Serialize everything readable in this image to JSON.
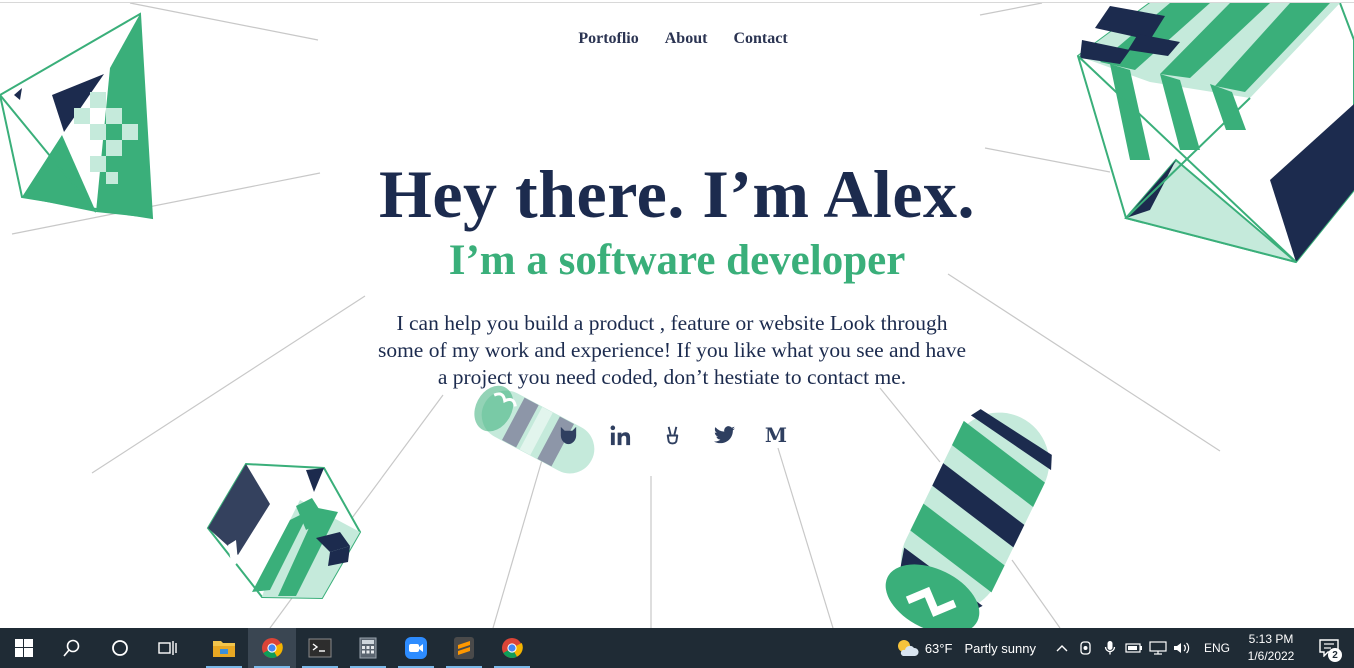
{
  "nav": {
    "items": [
      "Portoflio",
      "About",
      "Contact"
    ]
  },
  "hero": {
    "title": "Hey there. I’m Alex.",
    "subtitle": "I’m a software developer",
    "description": "I can help you build a product , feature or website Look through some of my work and experience! If you like what you see and have a project you need coded, don’t hestiate to contact me."
  },
  "socials": [
    {
      "icon": "github-icon"
    },
    {
      "icon": "linkedin-icon"
    },
    {
      "icon": "angellist-icon"
    },
    {
      "icon": "twitter-icon"
    },
    {
      "icon": "medium-icon",
      "glyph": "M"
    }
  ],
  "colors": {
    "navy": "#1c2b4e",
    "green": "#3aaf7a",
    "mint": "#c5eadb",
    "taskbar": "#1f2b35"
  },
  "taskbar": {
    "apps": [
      "start-icon",
      "search-icon",
      "cortana-icon",
      "task-view-icon",
      "file-explorer-icon",
      "chrome-icon",
      "terminal-icon",
      "calculator-icon",
      "zoom-icon",
      "sublime-text-icon",
      "chrome-icon"
    ],
    "weather": {
      "temp": "63°F",
      "condition": "Partly sunny"
    },
    "language": "ENG",
    "time": "5:13 PM",
    "date": "1/6/2022",
    "notification_count": "2"
  }
}
